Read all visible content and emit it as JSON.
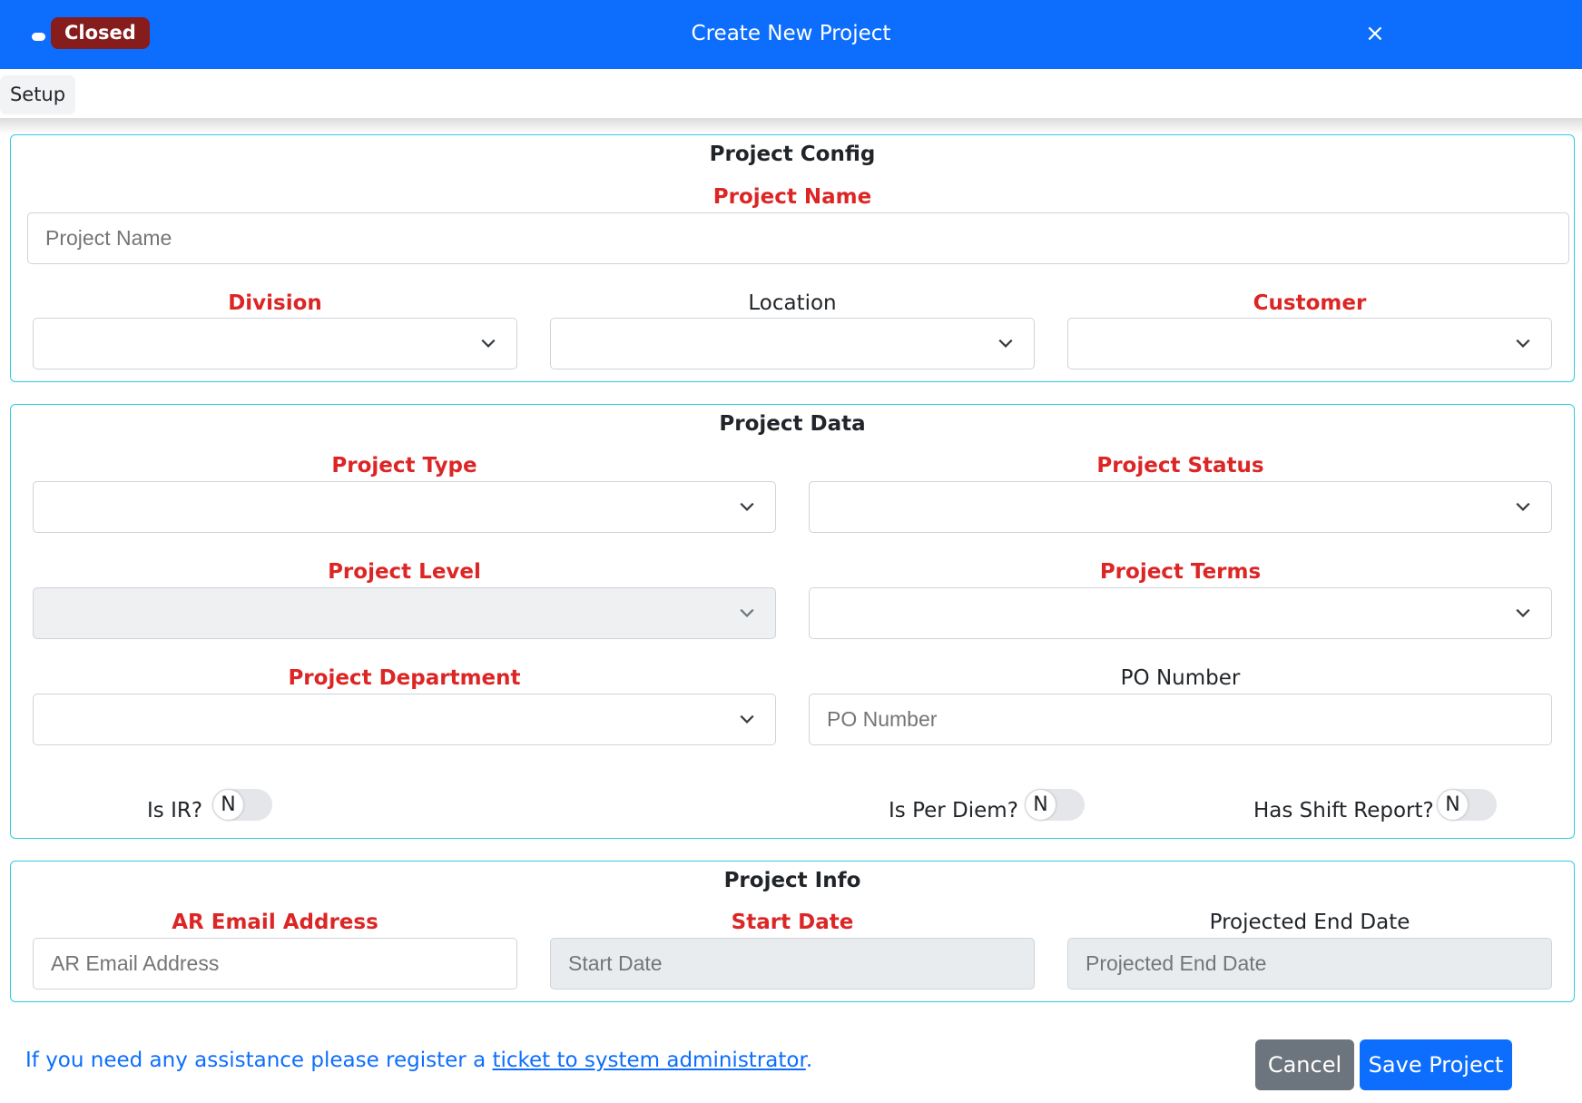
{
  "header": {
    "status_badge": "Closed",
    "title": "Create New Project",
    "close_icon": "×"
  },
  "tabs": [
    {
      "label": "Setup"
    }
  ],
  "project_config": {
    "title": "Project Config",
    "project_name": {
      "label": "Project Name",
      "placeholder": "Project Name",
      "value": ""
    },
    "division": {
      "label": "Division",
      "value": ""
    },
    "location": {
      "label": "Location",
      "value": ""
    },
    "customer": {
      "label": "Customer",
      "value": ""
    }
  },
  "project_data": {
    "title": "Project Data",
    "project_type": {
      "label": "Project Type",
      "value": ""
    },
    "project_status": {
      "label": "Project Status",
      "value": ""
    },
    "project_level": {
      "label": "Project Level",
      "value": ""
    },
    "project_terms": {
      "label": "Project Terms",
      "value": ""
    },
    "project_department": {
      "label": "Project Department",
      "value": ""
    },
    "po_number": {
      "label": "PO Number",
      "placeholder": "PO Number",
      "value": ""
    },
    "is_ir": {
      "label": "Is IR?",
      "state": "N"
    },
    "is_per_diem": {
      "label": "Is Per Diem?",
      "state": "N"
    },
    "has_shift_report": {
      "label": "Has Shift Report?",
      "state": "N"
    }
  },
  "project_info": {
    "title": "Project Info",
    "ar_email": {
      "label": "AR Email Address",
      "placeholder": "AR Email Address"
    },
    "start_date": {
      "label": "Start Date",
      "placeholder": "Start Date"
    },
    "projected_end_date": {
      "label": "Projected End Date",
      "placeholder": "Projected End Date"
    }
  },
  "footer": {
    "help_prefix": "If you need any assistance please register a ",
    "help_link": "ticket to system administrator",
    "help_suffix": ".",
    "cancel": "Cancel",
    "save": "Save Project"
  },
  "colors": {
    "primary": "#0d6efd",
    "required": "#dc2626",
    "badge": "#861c1c",
    "panel_border": "#2ecde0",
    "cancel": "#6c757d"
  }
}
